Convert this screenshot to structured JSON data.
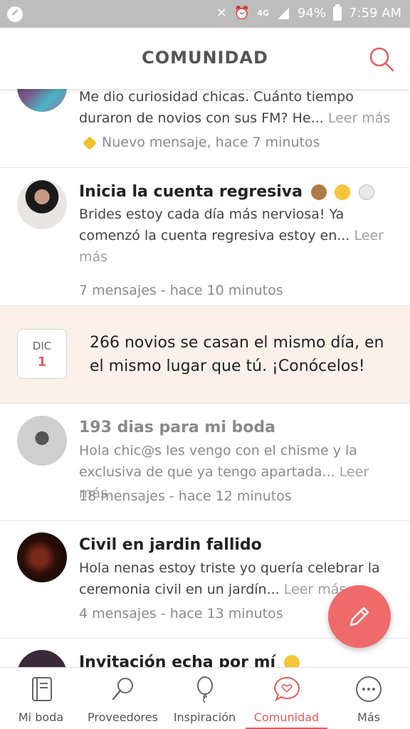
{
  "status_bar": {
    "battery": "94%",
    "time": "7:59 AM",
    "network": "4G"
  },
  "header": {
    "title": "COMUNIDAD"
  },
  "posts": [
    {
      "body": "Me dio curiosidad chicas. Cuánto tiempo duraron de novios con sus FM? He...",
      "more": "Leer más",
      "meta": "Nuevo mensaje, hace 7 minutos"
    },
    {
      "title": "Inicia la cuenta regresiva",
      "body": "Brides estoy cada día más nerviosa! Ya comenzó la cuenta regresiva estoy en...",
      "more": "Leer más",
      "meta": "7 mensajes - hace 10 minutos"
    },
    {
      "title": "193 dias para mi boda",
      "body": "Hola chic@s les vengo con el chisme y la exclusiva de que ya tengo apartada...",
      "more": "Leer más",
      "meta": "18 mensajes - hace 12 minutos"
    },
    {
      "title": "Civil en jardin fallido",
      "body": "Hola nenas estoy triste yo quería celebrar la ceremonia civil en un jardín...",
      "more": "Leer más",
      "meta": "4 mensajes - hace 13 minutos"
    },
    {
      "title": "Invitación echa por mí"
    }
  ],
  "promo": {
    "month": "DIC",
    "day": "1",
    "text": "266 novios se casan el mismo día, en el mismo lugar que tú. ¡Conócelos!"
  },
  "bottom_nav": [
    {
      "label": "Mi boda",
      "icon": "notebook-icon"
    },
    {
      "label": "Proveedores",
      "icon": "magnifier-icon"
    },
    {
      "label": "Inspiración",
      "icon": "balloon-icon"
    },
    {
      "label": "Comunidad",
      "icon": "chat-heart-icon",
      "active": true
    },
    {
      "label": "Más",
      "icon": "more-dots-icon"
    }
  ],
  "colors": {
    "accent": "#e85a5a",
    "fab": "#ef6a6a",
    "promo_bg": "#fbf1ea",
    "new_badge": "#f3c12b"
  }
}
